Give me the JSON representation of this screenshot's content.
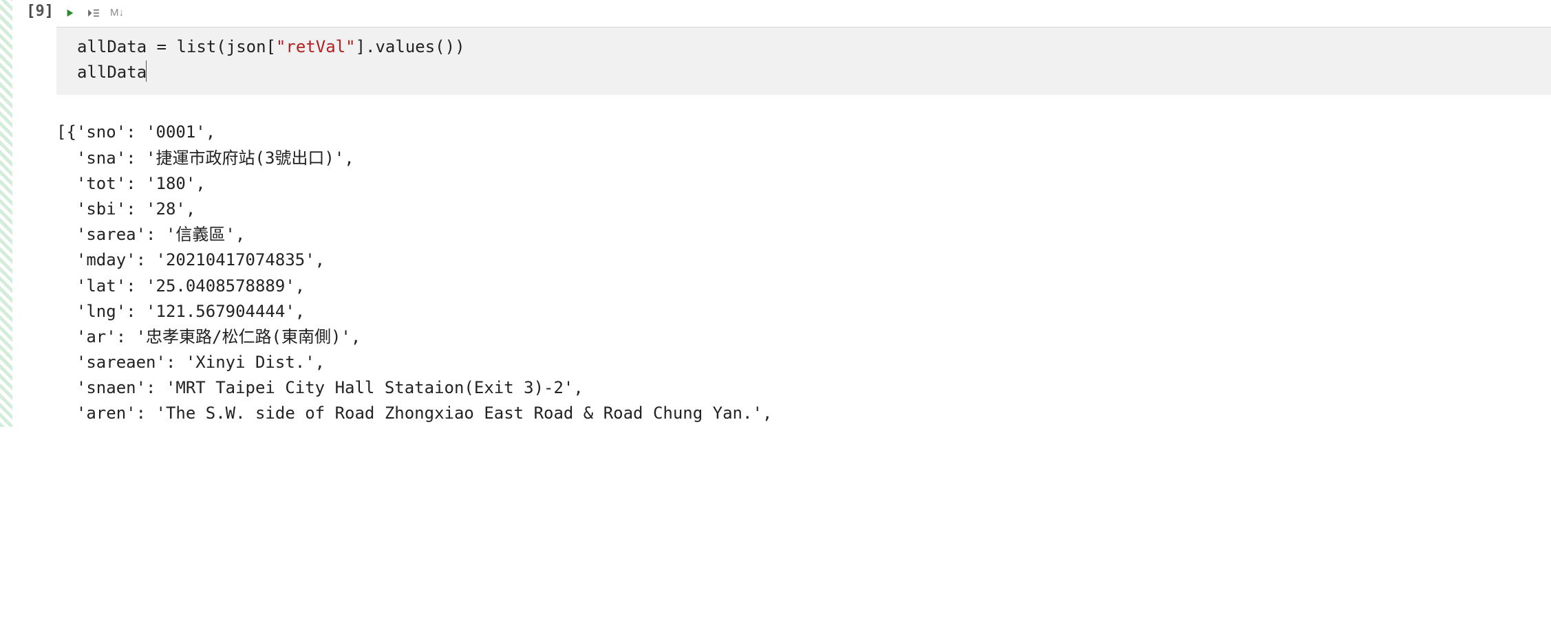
{
  "cell": {
    "execution_count": "9",
    "prompt_open": "[",
    "prompt_close": "]",
    "toolbar": {
      "run_label": "Run cell",
      "run_line_label": "Run line",
      "markdown_label": "M↓"
    },
    "code": {
      "line1_pre": "allData = list(json[",
      "line1_str": "\"retVal\"",
      "line1_post": "].values())",
      "line2": "allData"
    },
    "output_lines": [
      "[{'sno': '0001',",
      "  'sna': '捷運市政府站(3號出口)',",
      "  'tot': '180',",
      "  'sbi': '28',",
      "  'sarea': '信義區',",
      "  'mday': '20210417074835',",
      "  'lat': '25.0408578889',",
      "  'lng': '121.567904444',",
      "  'ar': '忠孝東路/松仁路(東南側)',",
      "  'sareaen': 'Xinyi Dist.',",
      "  'snaen': 'MRT Taipei City Hall Stataion(Exit 3)-2',",
      "  'aren': 'The S.W. side of Road Zhongxiao East Road & Road Chung Yan.',"
    ]
  }
}
